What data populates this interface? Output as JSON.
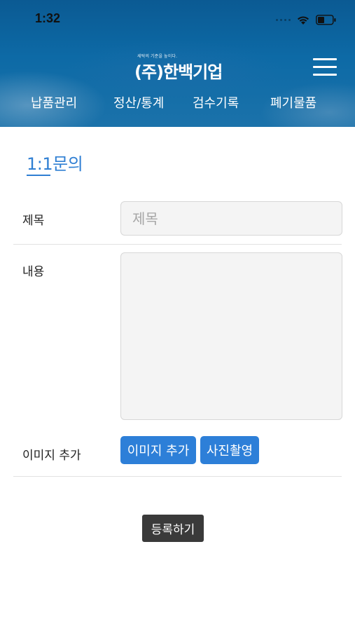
{
  "status_bar": {
    "time": "1:32"
  },
  "header": {
    "logo_tagline": "세탁의 기준을 높이다.",
    "logo_text": "(주)한백기업",
    "nav": [
      "납품관리",
      "정산/통계",
      "검수기록",
      "폐기물품"
    ]
  },
  "page": {
    "title": "1:1문의"
  },
  "form": {
    "subject_label": "제목",
    "subject_placeholder": "제목",
    "subject_value": "",
    "content_label": "내용",
    "content_value": "",
    "image_label": "이미지 추가",
    "add_image_button": "이미지 추가",
    "take_photo_button": "사진촬영",
    "submit_button": "등록하기"
  },
  "colors": {
    "header_blue": "#0d6aa6",
    "accent_blue": "#2d7fd8",
    "submit_dark": "#3a3a3a"
  },
  "icons": [
    "wifi-icon",
    "battery-icon",
    "hamburger-menu-icon"
  ]
}
